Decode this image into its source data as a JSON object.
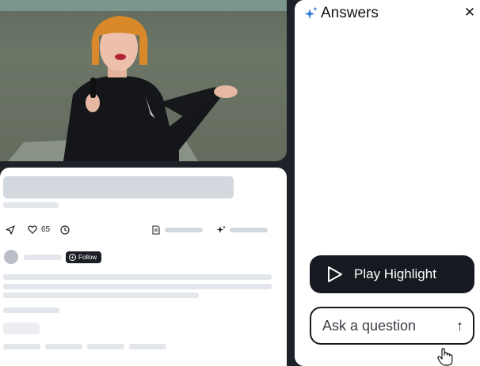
{
  "post": {
    "likes": "65"
  },
  "author": {
    "follow_label": "Follow"
  },
  "answers_panel": {
    "title": "Answers",
    "play_label": "Play Highlight",
    "ask_placeholder": "Ask a question",
    "accent_color": "#2f7bd6"
  },
  "icons": {
    "share": "send-icon",
    "like": "heart-icon",
    "history": "clock-icon",
    "sparkle": "sparkle-icon",
    "close": "close-icon",
    "play": "play-icon",
    "send": "arrow-up-icon",
    "cursor": "hand-pointer-icon"
  }
}
